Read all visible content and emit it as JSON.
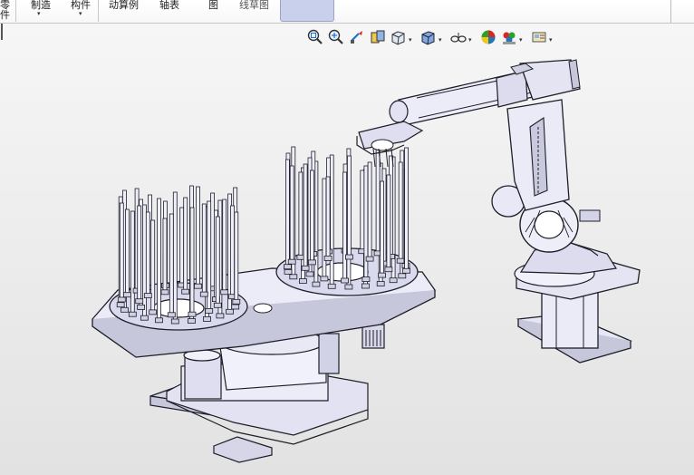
{
  "ribbon": {
    "items": [
      {
        "label_top": "零",
        "label_bottom": "件",
        "has_dropdown": false
      },
      {
        "label_top": "制造",
        "label_bottom": "",
        "has_dropdown": true
      },
      {
        "label_top": "构件",
        "label_bottom": "",
        "has_dropdown": true
      },
      {
        "label_top": "动算例",
        "label_bottom": "",
        "has_dropdown": false
      },
      {
        "label_top": "轴表",
        "label_bottom": "",
        "has_dropdown": false
      },
      {
        "label_top": "图",
        "label_bottom": "",
        "has_dropdown": false
      },
      {
        "label_top": "线草图",
        "label_bottom": "",
        "has_dropdown": false
      }
    ],
    "dropdown_glyph": "▾"
  },
  "view_toolbar": {
    "icons": [
      "zoom-to-fit-icon",
      "zoom-to-area-icon",
      "previous-view-icon",
      "section-view-icon",
      "view-orientation-icon",
      "display-style-icon",
      "hide-show-items-icon",
      "edit-appearance-icon",
      "apply-scene-icon",
      "view-settings-icon"
    ],
    "dropdown_glyph": "▾"
  },
  "colors": {
    "model_fill": "#e7e7f5",
    "model_shade": "#c7c7dc",
    "model_edge": "#1e1e28",
    "active_button": "#c9d0ec",
    "background_top": "#ffffff",
    "background_bottom": "#e2e2e2"
  }
}
